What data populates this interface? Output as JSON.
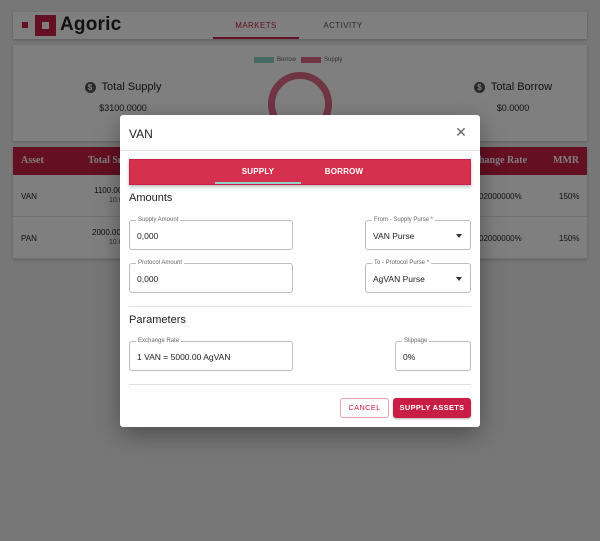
{
  "brand": {
    "name": "Agoric",
    "accent": "#c81e45"
  },
  "nav": {
    "tabs": [
      {
        "label": "MARKETS"
      },
      {
        "label": "ACTIVITY"
      }
    ]
  },
  "summary": {
    "legend": [
      {
        "label": "Borrow",
        "color": "#8fd3c8"
      },
      {
        "label": "Supply",
        "color": "#e16985"
      }
    ],
    "total_supply": {
      "title": "Total Supply",
      "value": "$3100.0000"
    },
    "total_borrow": {
      "title": "Total Borrow",
      "value": "$0.0000"
    }
  },
  "table": {
    "headers": {
      "asset": "Asset",
      "total_supply": "Total Su",
      "exchange_rate": "hange Rate",
      "mmr": "MMR"
    },
    "rows": [
      {
        "asset": "VAN",
        "supply_main": "1100.00",
        "supply_sub": "10.0",
        "rate": "02000000%",
        "mmr": "150%"
      },
      {
        "asset": "PAN",
        "supply_main": "2000.00",
        "supply_sub": "10.0",
        "rate": "02000000%",
        "mmr": "150%"
      }
    ]
  },
  "dialog": {
    "title": "VAN",
    "close_icon": "close-icon",
    "tabs": [
      {
        "label": "SUPPLY"
      },
      {
        "label": "BORROW"
      }
    ],
    "amounts_heading": "Amounts",
    "supply_amount": {
      "label": "Supply Amount",
      "value": "0,000"
    },
    "from_purse": {
      "label": "From - Supply Purse *",
      "value": "VAN Purse"
    },
    "protocol_amount": {
      "label": "Protocol Amount",
      "value": "0,000"
    },
    "to_purse": {
      "label": "To - Protocol Purse *",
      "value": "AgVAN Purse"
    },
    "parameters_heading": "Parameters",
    "exchange_rate": {
      "label": "Exchange Rate",
      "value": "1 VAN = 5000.00 AgVAN"
    },
    "slippage": {
      "label": "Slippage",
      "value": "0%"
    },
    "cancel_label": "CANCEL",
    "submit_label": "SUPPLY ASSETS"
  }
}
